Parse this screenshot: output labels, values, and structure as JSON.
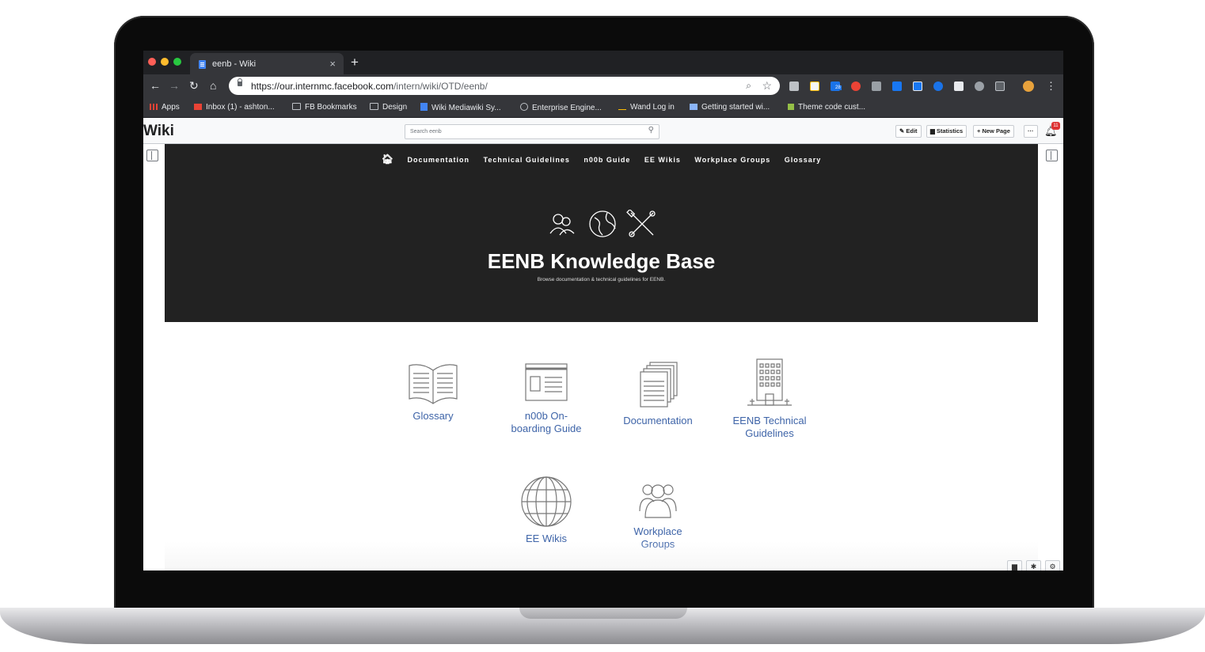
{
  "browser": {
    "tab_title": "eenb - Wiki",
    "tab_close": "×",
    "new_tab": "+",
    "url_host": "https://our.internmc.facebook.com",
    "url_path": "/intern/wiki/OTD/eenb/",
    "calendar_badge": "28",
    "bookmarks": [
      {
        "label": "Apps"
      },
      {
        "label": "Inbox (1) - ashton..."
      },
      {
        "label": "FB Bookmarks"
      },
      {
        "label": "Design"
      },
      {
        "label": "Wiki Mediawiki Sy..."
      },
      {
        "label": "Enterprise Engine..."
      },
      {
        "label": "Wand Log in"
      },
      {
        "label": "Getting started wi..."
      },
      {
        "label": "Theme code cust..."
      }
    ]
  },
  "wiki": {
    "logo": "Wiki",
    "search_placeholder": "Search eenb",
    "buttons": {
      "edit": "✎ Edit",
      "statistics": "▆ Statistics",
      "new_page": "+ New Page",
      "more": "···"
    },
    "notification_count": "11"
  },
  "hero": {
    "nav": [
      "Documentation",
      "Technical Guidelines",
      "n00b Guide",
      "EE Wikis",
      "Workplace Groups",
      "Glossary"
    ],
    "title": "EENB Knowledge Base",
    "subtitle": "Browse documentation & technical guidelines for EENB."
  },
  "cards": [
    {
      "label_1": "Glossary",
      "label_2": ""
    },
    {
      "label_1": "n00b On-",
      "label_2": "boarding Guide"
    },
    {
      "label_1": "Documentation",
      "label_2": ""
    },
    {
      "label_1": "EENB Technical",
      "label_2": "Guidelines"
    },
    {
      "label_1": "EE Wikis",
      "label_2": ""
    },
    {
      "label_1": "Workplace",
      "label_2": "Groups"
    }
  ],
  "colors": {
    "hero_bg": "#222222",
    "card_link": "#3e64a8",
    "chrome_dark": "#202124",
    "chrome_toolbar": "#35363a"
  }
}
